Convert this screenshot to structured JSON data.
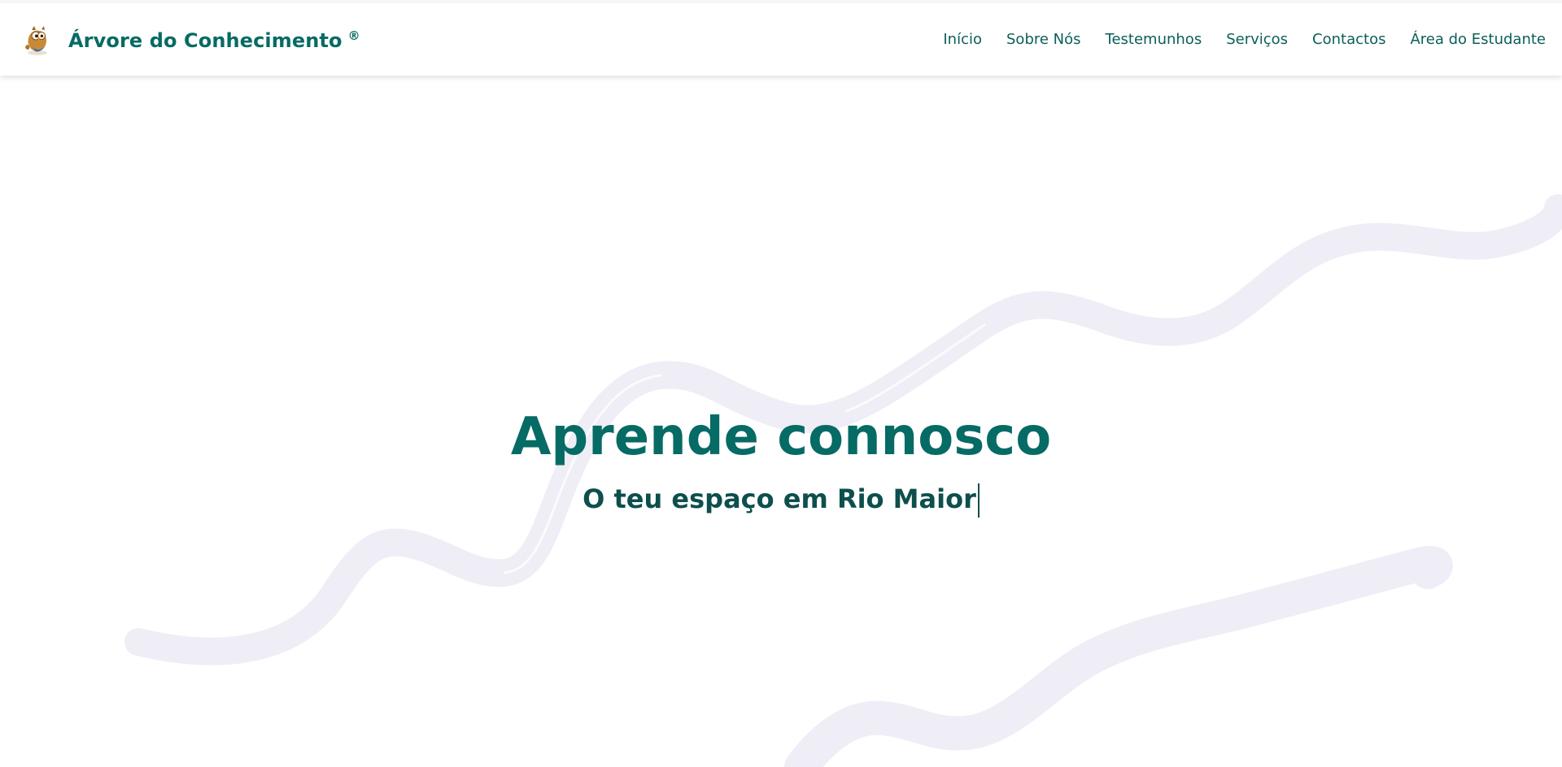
{
  "header": {
    "brand_name": "Árvore do Conhecimento",
    "brand_mark": "®",
    "logo_icon": "owl-mascot-icon",
    "nav": [
      {
        "label": "Início"
      },
      {
        "label": "Sobre Nós"
      },
      {
        "label": "Testemunhos"
      },
      {
        "label": "Serviços"
      },
      {
        "label": "Contactos"
      },
      {
        "label": "Área do Estudante"
      }
    ]
  },
  "hero": {
    "title": "Aprende connosco",
    "subtitle": "O teu espaço em Rio Maior"
  },
  "colors": {
    "accent": "#066b64",
    "accent_dark": "#0d4f4c",
    "wave": "#efedf5",
    "background": "#ffffff"
  }
}
